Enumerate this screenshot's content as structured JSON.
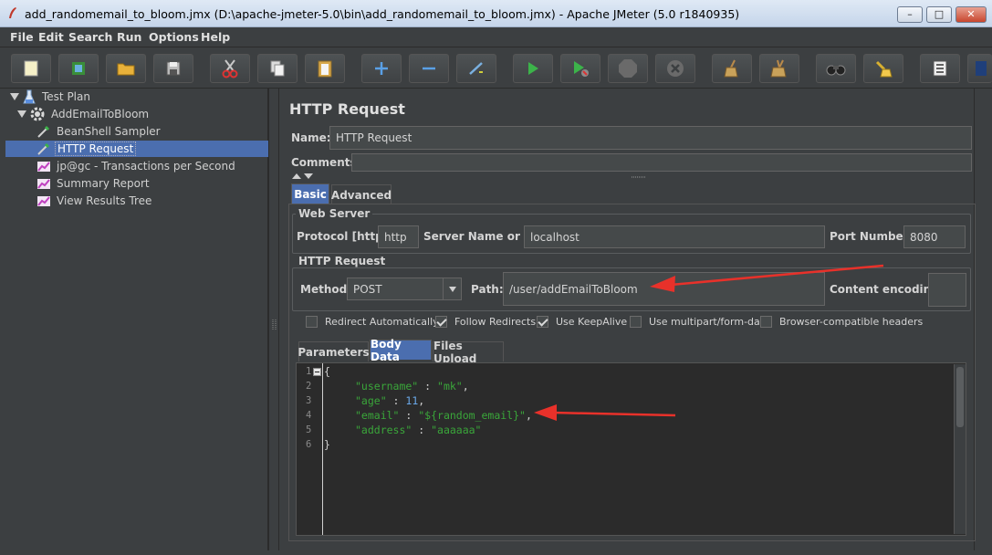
{
  "window": {
    "title": "add_randomemail_to_bloom.jmx (D:\\apache-jmeter-5.0\\bin\\add_randomemail_to_bloom.jmx) - Apache JMeter (5.0 r1840935)",
    "min": "–",
    "max": "□",
    "close": "✕"
  },
  "menu": {
    "file": "File",
    "edit": "Edit",
    "search": "Search",
    "run": "Run",
    "options": "Options",
    "help": "Help"
  },
  "tree": {
    "items": [
      {
        "label": "Test Plan",
        "icon": "flask-icon"
      },
      {
        "label": "AddEmailToBloom",
        "icon": "gear-icon"
      },
      {
        "label": "BeanShell Sampler",
        "icon": "pipette-icon"
      },
      {
        "label": "HTTP Request",
        "icon": "pipette-icon"
      },
      {
        "label": "jp@gc - Transactions per Second",
        "icon": "chart-icon"
      },
      {
        "label": "Summary Report",
        "icon": "chart-icon"
      },
      {
        "label": "View Results Tree",
        "icon": "chart-icon"
      }
    ]
  },
  "panel": {
    "heading": "HTTP Request",
    "name_label": "Name:",
    "name_value": "HTTP Request",
    "comments_label": "Comments:",
    "tabs": [
      "Basic",
      "Advanced"
    ],
    "web_server": {
      "title": "Web Server",
      "protocol_label": "Protocol [http]:",
      "protocol_value": "http",
      "server_label": "Server Name or IP:",
      "server_value": "localhost",
      "port_label": "Port Number:",
      "port_value": "8080"
    },
    "http_request": {
      "title": "HTTP Request",
      "method_label": "Method:",
      "method_value": "POST",
      "path_label": "Path:",
      "path_value": "/user/addEmailToBloom",
      "encoding_label": "Content encoding:",
      "encoding_value": ""
    },
    "checkboxes": [
      {
        "label": "Redirect Automatically",
        "checked": false
      },
      {
        "label": "Follow Redirects",
        "checked": true
      },
      {
        "label": "Use KeepAlive",
        "checked": true
      },
      {
        "label": "Use multipart/form-data",
        "checked": false
      },
      {
        "label": "Browser-compatible headers",
        "checked": false
      }
    ],
    "subtabs": [
      "Parameters",
      "Body Data",
      "Files Upload"
    ],
    "body": {
      "line_numbers": [
        "1",
        "2",
        "3",
        "4",
        "5",
        "6"
      ],
      "open_brace": "{",
      "close_brace": "}",
      "lines": [
        {
          "key": "\"username\"",
          "sep": " : ",
          "value": "\"mk\"",
          "tail": ","
        },
        {
          "key": "\"age\"",
          "sep": " : ",
          "value": "11",
          "tail": ","
        },
        {
          "key": "\"email\"",
          "sep": " : ",
          "value": "\"${random_email}\"",
          "tail": ","
        },
        {
          "key": "\"address\"",
          "sep": " : ",
          "value": "\"aaaaaa\"",
          "tail": ""
        }
      ]
    }
  },
  "colors": {
    "background": "#3c3f41",
    "selection": "#4b6eaf",
    "json_string": "#3aa63a",
    "json_number": "#6aa8e8",
    "annotation_arrow": "#e8312a"
  }
}
